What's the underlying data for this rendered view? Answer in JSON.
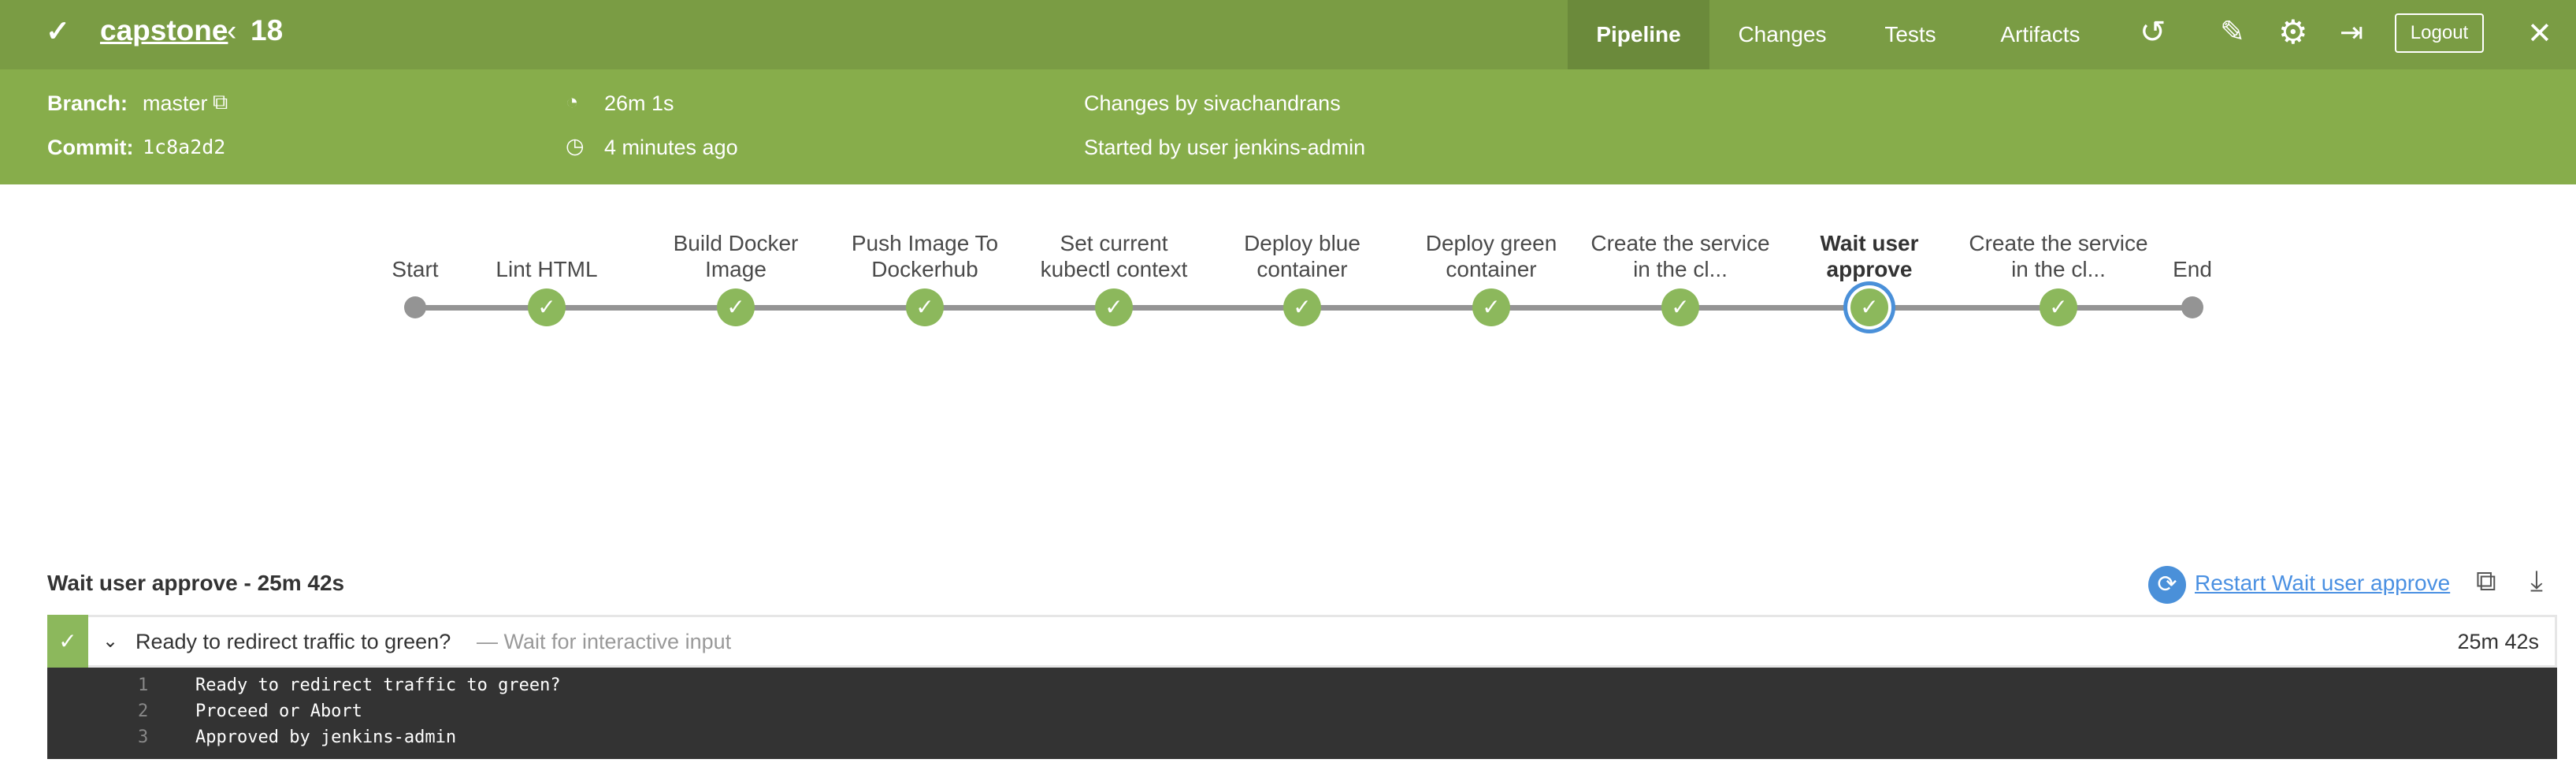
{
  "header": {
    "status_icon": "check-icon",
    "project": "capstone",
    "back_icon": "chevron-left-icon",
    "run_number": "18",
    "tabs": [
      {
        "label": "Pipeline",
        "active": true
      },
      {
        "label": "Changes"
      },
      {
        "label": "Tests"
      },
      {
        "label": "Artifacts"
      }
    ],
    "logout_label": "Logout",
    "close_label": "✕"
  },
  "meta": {
    "branch_label": "Branch:",
    "branch": "master",
    "commit_label": "Commit:",
    "commit": "1c8a2d2",
    "duration": "26m 1s",
    "started": "4 minutes ago",
    "changes": "Changes by sivachandrans",
    "started_by": "Started by user jenkins-admin"
  },
  "pipeline": {
    "stages": [
      {
        "line1": "",
        "line2": "Start",
        "type": "term"
      },
      {
        "line1": "",
        "line2": "Lint HTML",
        "type": "ok"
      },
      {
        "line1": "Build Docker",
        "line2": "Image",
        "type": "ok"
      },
      {
        "line1": "Push Image To",
        "line2": "Dockerhub",
        "type": "ok"
      },
      {
        "line1": "Set current",
        "line2": "kubectl context",
        "type": "ok"
      },
      {
        "line1": "Deploy blue",
        "line2": "container",
        "type": "ok"
      },
      {
        "line1": "Deploy green",
        "line2": "container",
        "type": "ok"
      },
      {
        "line1": "Create the service",
        "line2": "in the cl...",
        "type": "ok"
      },
      {
        "line1": "Wait user",
        "line2": "approve",
        "type": "ok",
        "selected": true
      },
      {
        "line1": "Create the service",
        "line2": "in the cl...",
        "type": "ok"
      },
      {
        "line1": "",
        "line2": "End",
        "type": "term"
      }
    ]
  },
  "log": {
    "title": "Wait user approve - 25m 42s",
    "restart_label": "Restart Wait user approve",
    "step": {
      "label": "Ready to redirect traffic to green?",
      "desc": "— Wait for interactive input",
      "duration": "25m 42s"
    },
    "lines": [
      {
        "n": "1",
        "text": "Ready to redirect traffic to green?"
      },
      {
        "n": "2",
        "text": "Proceed or Abort"
      },
      {
        "n": "3",
        "text": "Approved by jenkins-admin"
      }
    ]
  }
}
